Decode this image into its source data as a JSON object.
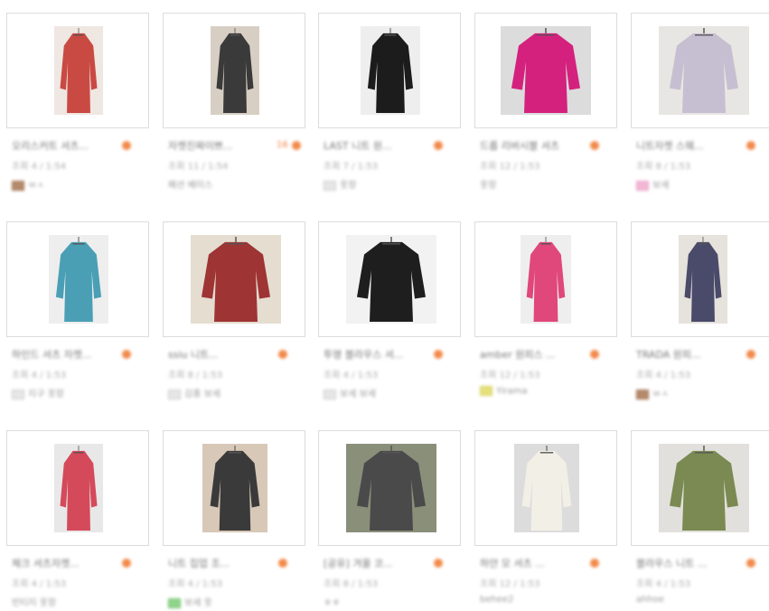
{
  "products": [
    {
      "title": "오리스커트 셔츠...",
      "count": "",
      "views": "조회 4 / 1:54",
      "seller": "ㅂㅅ",
      "seller_icon": "brown",
      "photo_color": "#c94a43",
      "photo_bg": "#efe7e2"
    },
    {
      "title": "자켓진짜이쁘...",
      "count": "16",
      "views": "조회 11 / 1:54",
      "seller": "패션 베이스",
      "seller_icon": "none",
      "photo_color": "#3a3a3a",
      "photo_bg": "#d8cfc4"
    },
    {
      "title": "LAST 니트 원...",
      "count": "",
      "views": "조회 7 / 1:53",
      "seller": "옷장",
      "seller_icon": "grey",
      "photo_color": "#1c1c1c",
      "photo_bg": "#eeeeee"
    },
    {
      "title": "드롭 리버시블 셔츠",
      "count": "",
      "views": "조회 12 / 1:53",
      "seller": "옷장",
      "seller_icon": "none",
      "photo_color": "#d4217e",
      "photo_bg": "#dcdcdc"
    },
    {
      "title": "니트자켓 스웨...",
      "count": "",
      "views": "조회 8 / 1:53",
      "seller": "보세",
      "seller_icon": "pink",
      "photo_color": "#c6bfd2",
      "photo_bg": "#e8e6e2"
    },
    {
      "title": "하인드 셔츠 자켓...",
      "count": "",
      "views": "조회 4 / 1:53",
      "seller": "지구 옷장",
      "seller_icon": "grey",
      "photo_color": "#4a9fb5",
      "photo_bg": "#eeeeee"
    },
    {
      "title": "ssiu 니트...",
      "count": "",
      "views": "조회 8 / 1:53",
      "seller": "김홍 보세",
      "seller_icon": "grey",
      "photo_color": "#9e3434",
      "photo_bg": "#e4ddd0"
    },
    {
      "title": "투명 블라우스 셔...",
      "count": "",
      "views": "조회 4 / 1:53",
      "seller": "보세 보세",
      "seller_icon": "grey",
      "photo_color": "#1e1e1e",
      "photo_bg": "#f2f2f2"
    },
    {
      "title": "amber 원피스 ...",
      "count": "",
      "views": "조회 12 / 1:53",
      "seller": "Yirama",
      "seller_icon": "yellow",
      "photo_color": "#e0477a",
      "photo_bg": "#eeeeee"
    },
    {
      "title": "TRADA 원피...",
      "count": "",
      "views": "조회 4 / 1:53",
      "seller": "ㅂㅅ",
      "seller_icon": "brown",
      "photo_color": "#4a4a6a",
      "photo_bg": "#e6e2dc"
    },
    {
      "title": "체크 셔츠자켓...",
      "count": "",
      "views": "조회 4 / 1:53",
      "seller": "빈티지 옷장",
      "seller_icon": "none",
      "photo_color": "#d44a5a",
      "photo_bg": "#e8e8e8"
    },
    {
      "title": "니트 집업 조...",
      "count": "",
      "views": "조회 4 / 1:53",
      "seller": "보세 옷",
      "seller_icon": "green",
      "photo_color": "#3a3a3a",
      "photo_bg": "#d8c8b8"
    },
    {
      "title": "[공유] 겨울 코...",
      "count": "",
      "views": "조회 8 / 1:53",
      "seller": "ㅎㅎ",
      "seller_icon": "none",
      "photo_color": "#4a4a4a",
      "photo_bg": "#8a8f7a"
    },
    {
      "title": "하얀 모 셔츠 ...",
      "count": "",
      "views": "조회 12 / 1:53",
      "seller": "behee2",
      "seller_icon": "none",
      "photo_color": "#f2efe6",
      "photo_bg": "#dcdcdc"
    },
    {
      "title": "블라우스 니트 ...",
      "count": "",
      "views": "조회 4 / 1:53",
      "seller": "ahhoe",
      "seller_icon": "none",
      "photo_color": "#7a8a52",
      "photo_bg": "#e2e0dc"
    }
  ]
}
